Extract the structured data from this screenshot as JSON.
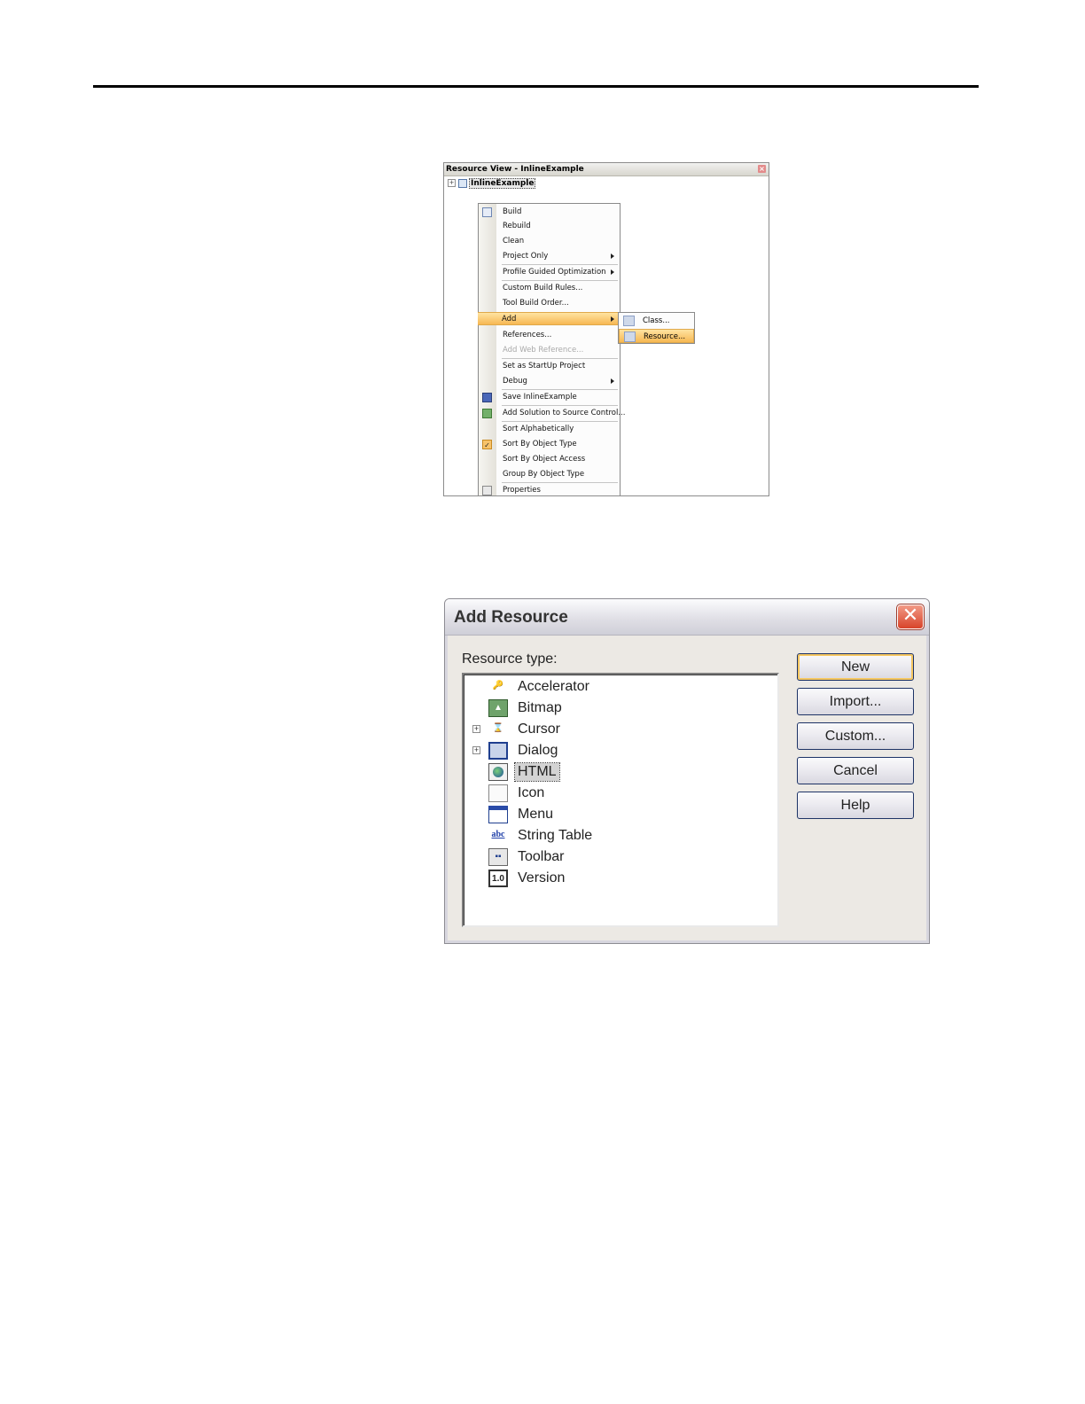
{
  "resource_view": {
    "title": "Resource View - InlineExample",
    "close_glyph": "×",
    "expand_glyph": "+",
    "project": "InlineExample"
  },
  "context_menu": {
    "items": [
      {
        "label": "Build",
        "icon": "build-icon"
      },
      {
        "label": "Rebuild"
      },
      {
        "label": "Clean"
      },
      {
        "label": "Project Only",
        "submenu": true
      },
      {
        "label": "Profile Guided Optimization",
        "submenu": true
      },
      {
        "label": "Custom Build Rules..."
      },
      {
        "label": "Tool Build Order..."
      },
      {
        "label": "Add",
        "submenu": true,
        "highlighted": true
      },
      {
        "label": "References..."
      },
      {
        "label": "Add Web Reference...",
        "disabled": true
      },
      {
        "label": "Set as StartUp Project"
      },
      {
        "label": "Debug",
        "submenu": true
      },
      {
        "label": "Save InlineExample",
        "icon": "save-icon"
      },
      {
        "label": "Add Solution to Source Control...",
        "icon": "source-control-icon"
      },
      {
        "label": "Sort Alphabetically"
      },
      {
        "label": "Sort By Object Type",
        "icon": "checkmark-icon",
        "checked": true
      },
      {
        "label": "Sort By Object Access"
      },
      {
        "label": "Group By Object Type"
      },
      {
        "label": "Properties",
        "icon": "properties-icon"
      }
    ],
    "check_glyph": "✓"
  },
  "add_submenu": {
    "items": [
      {
        "label": "Class..."
      },
      {
        "label": "Resource...",
        "highlighted": true
      }
    ]
  },
  "dialog": {
    "title": "Add Resource",
    "close_glyph": "✕",
    "resource_type_label": "Resource type:",
    "resource_types": [
      {
        "label": "Accelerator",
        "icon": "accelerator-icon",
        "glyph": "🔑"
      },
      {
        "label": "Bitmap",
        "icon": "bitmap-icon",
        "glyph": "▲"
      },
      {
        "label": "Cursor",
        "icon": "cursor-icon",
        "glyph": "⌛",
        "expandable": true
      },
      {
        "label": "Dialog",
        "icon": "dialog-icon",
        "glyph": "",
        "expandable": true
      },
      {
        "label": "HTML",
        "icon": "html-icon",
        "glyph": "",
        "selected": true
      },
      {
        "label": "Icon",
        "icon": "icon-resource-icon",
        "glyph": ""
      },
      {
        "label": "Menu",
        "icon": "menu-icon",
        "glyph": ""
      },
      {
        "label": "String Table",
        "icon": "string-table-icon",
        "glyph": "abc"
      },
      {
        "label": "Toolbar",
        "icon": "toolbar-icon",
        "glyph": "▪▪"
      },
      {
        "label": "Version",
        "icon": "version-icon",
        "glyph": "1.0"
      }
    ],
    "expand_glyph": "+",
    "buttons": {
      "new": "New",
      "import": "Import...",
      "custom": "Custom...",
      "cancel": "Cancel",
      "help": "Help"
    }
  }
}
